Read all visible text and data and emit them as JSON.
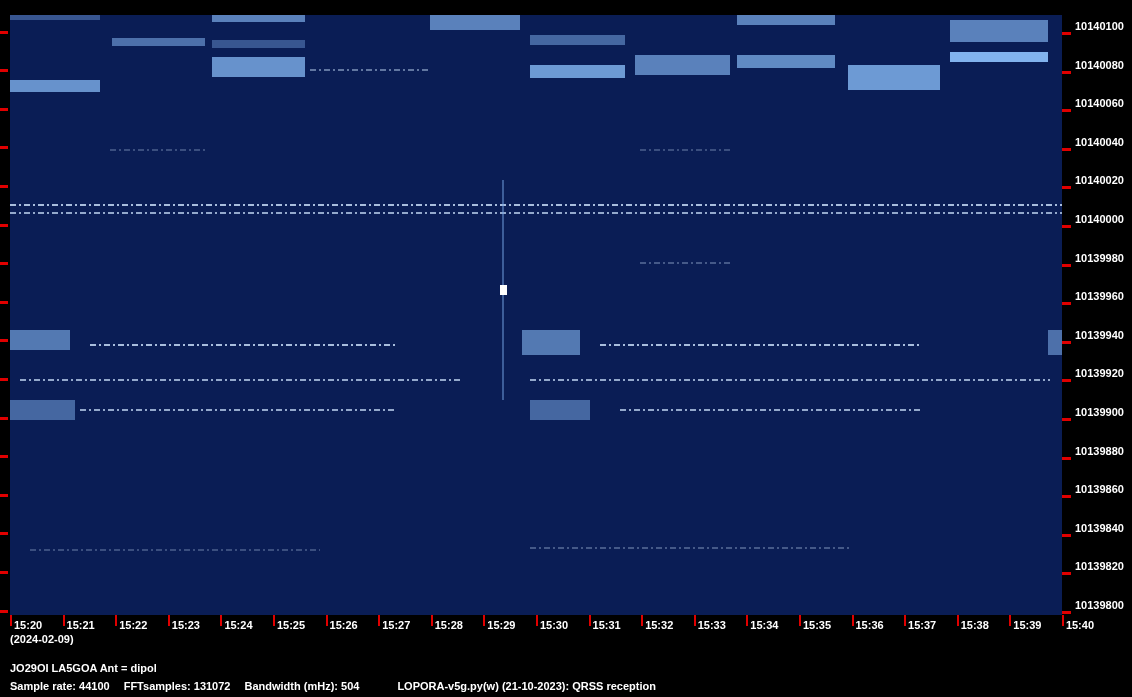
{
  "frequency_axis": {
    "labels": [
      "10140100",
      "10140080",
      "10140060",
      "10140040",
      "10140020",
      "10140000",
      "10139980",
      "10139960",
      "10139940",
      "10139920",
      "10139900",
      "10139880",
      "10139860",
      "10139840",
      "10139820",
      "10139800"
    ]
  },
  "time_axis": {
    "labels": [
      "15:20",
      "15:21",
      "15:22",
      "15:23",
      "15:24",
      "15:25",
      "15:26",
      "15:27",
      "15:28",
      "15:29",
      "15:30",
      "15:31",
      "15:32",
      "15:33",
      "15:34",
      "15:35",
      "15:36",
      "15:37",
      "15:38",
      "15:39",
      "15:40"
    ],
    "date": "(2024-02-09)"
  },
  "station": "JO29OI LA5GOA Ant = dipol",
  "info": [
    "Sample rate: 44100",
    "FFTsamples: 131072",
    "Bandwidth (mHz): 504",
    "LOPORA-v5g.py(w) (21-10-2023): QRSS reception"
  ]
}
